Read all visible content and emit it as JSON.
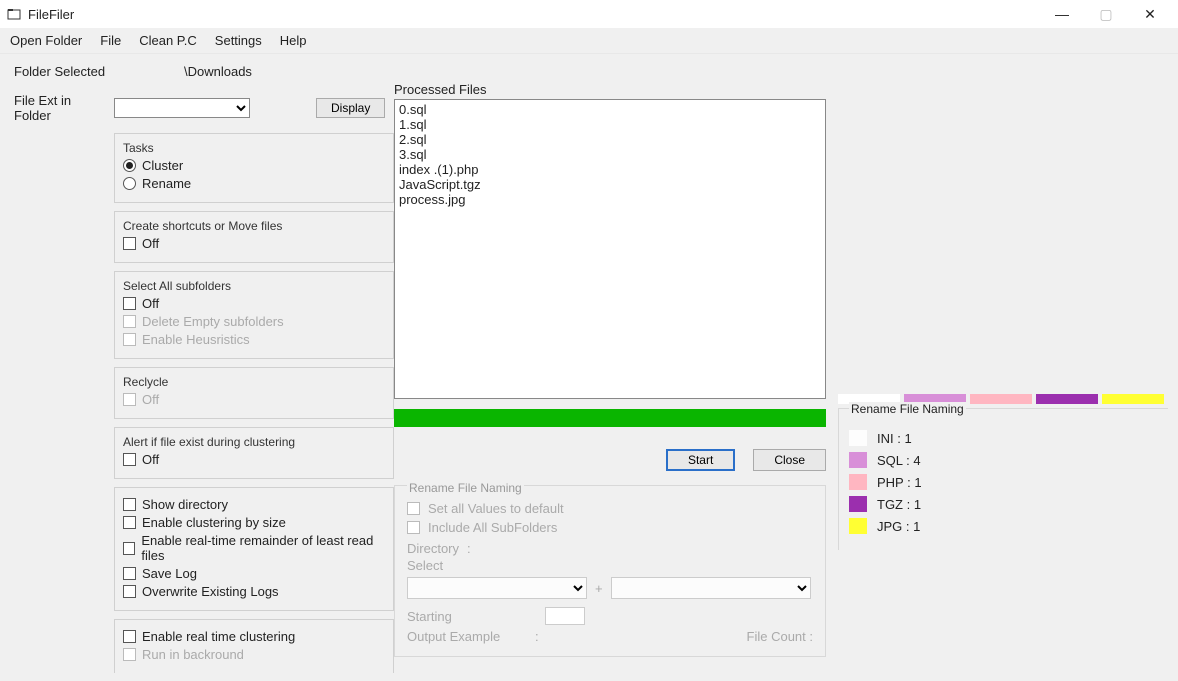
{
  "window": {
    "title": "FileFiler"
  },
  "menu": {
    "items": [
      "Open Folder",
      "File",
      "Clean P.C",
      "Settings",
      "Help"
    ]
  },
  "header": {
    "folder_selected_label": "Folder Selected",
    "folder_selected_value": "\\Downloads",
    "file_ext_label": "File Ext in Folder",
    "display_btn": "Display"
  },
  "tasks": {
    "groupLabel": "Tasks",
    "cluster": "Cluster",
    "rename": "Rename",
    "selected": "cluster"
  },
  "shortcuts": {
    "groupLabel": "Create shortcuts or Move files",
    "off": "Off"
  },
  "subfolders": {
    "groupLabel": "Select All subfolders",
    "off": "Off",
    "delete_empty": "Delete Empty subfolders",
    "enable_heur": "Enable Heusristics"
  },
  "recycle": {
    "groupLabel": "Reclycle",
    "off": "Off"
  },
  "alert": {
    "groupLabel": "Alert if file exist during clustering",
    "off": "Off"
  },
  "options1": {
    "show_dir": "Show directory",
    "cluster_size": "Enable clustering by size",
    "realtime_remainder": "Enable real-time remainder of least read files",
    "save_log": "Save Log",
    "overwrite_logs": "Overwrite Existing Logs"
  },
  "options2": {
    "realtime_cluster": "Enable real time clustering",
    "run_bg": "Run in backround"
  },
  "processed": {
    "label": "Processed Files",
    "items": [
      "0.sql",
      "1.sql",
      "2.sql",
      "3.sql",
      "index .(1).php",
      "JavaScript.tgz",
      "process.jpg"
    ]
  },
  "actions": {
    "start": "Start",
    "close": "Close"
  },
  "renameGroup": {
    "label": "Rename File Naming",
    "set_defaults": "Set all Values to default",
    "include_sub": "Include All SubFolders",
    "directory": "Directory",
    "select": "Select",
    "plus": "+",
    "starting": "Starting",
    "output_example": "Output Example",
    "colon": ":",
    "file_count": "File Count  :"
  },
  "legend": {
    "label": "Rename File Naming",
    "swatches": [
      "#ffffff",
      "#d88fd8",
      "#ffb6c1",
      "#9b2fae",
      "#ffff33"
    ],
    "items": [
      {
        "color": "#fdfdfd",
        "text": "INI : 1"
      },
      {
        "color": "#d88fd8",
        "text": "SQL : 4"
      },
      {
        "color": "#ffb6c1",
        "text": "PHP : 1"
      },
      {
        "color": "#9b2fae",
        "text": "TGZ : 1"
      },
      {
        "color": "#ffff33",
        "text": "JPG : 1"
      }
    ]
  },
  "chart_data": {
    "type": "table",
    "title": "File extension counts",
    "categories": [
      "INI",
      "SQL",
      "PHP",
      "TGZ",
      "JPG"
    ],
    "values": [
      1,
      4,
      1,
      1,
      1
    ]
  }
}
